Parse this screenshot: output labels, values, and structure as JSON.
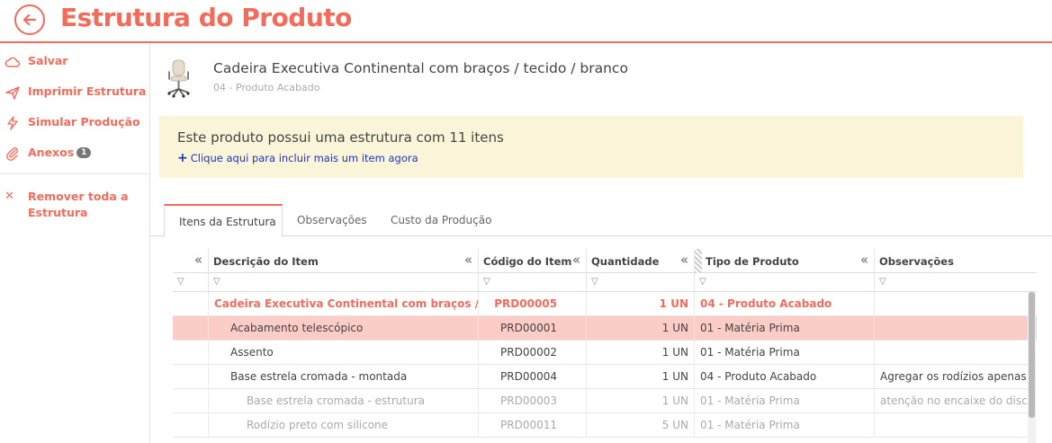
{
  "header": {
    "title": "Estrutura do Produto"
  },
  "sidebar": {
    "items": [
      {
        "label": "Salvar",
        "icon": "cloud-icon"
      },
      {
        "label": "Imprimir Estrutura",
        "icon": "send-icon"
      },
      {
        "label": "Simular Produção",
        "icon": "lightning-icon"
      },
      {
        "label": "Anexos",
        "icon": "paperclip-icon",
        "badge": "1"
      }
    ],
    "remove": {
      "label": "Remover toda a Estrutura",
      "icon": "close-icon"
    }
  },
  "product": {
    "name": "Cadeira Executiva Continental com braços / tecido / branco",
    "type": "04 - Produto Acabado"
  },
  "notice": {
    "text": "Este produto possui uma estrutura com 11 itens",
    "link": "Clique aqui para incluir mais um item agora"
  },
  "tabs": [
    {
      "label": "Itens da Estrutura",
      "active": true
    },
    {
      "label": "Observações",
      "active": false
    },
    {
      "label": "Custo da Produção",
      "active": false
    }
  ],
  "grid": {
    "columns": [
      "Descrição do Item",
      "Código do Item",
      "Quantidade",
      "Tipo de Produto",
      "Observações"
    ],
    "rows": [
      {
        "desc": "Cadeira Executiva Continental com braços / te...",
        "code": "PRD00005",
        "qty": "1 UN",
        "type": "04 - Produto Acabado",
        "obs": ""
      },
      {
        "desc": "Acabamento telescópico",
        "code": "PRD00001",
        "qty": "1 UN",
        "type": "01 - Matéria Prima",
        "obs": ""
      },
      {
        "desc": "Assento",
        "code": "PRD00002",
        "qty": "1 UN",
        "type": "01 - Matéria Prima",
        "obs": ""
      },
      {
        "desc": "Base estrela cromada - montada",
        "code": "PRD00004",
        "qty": "1 UN",
        "type": "04 - Produto Acabado",
        "obs": "Agregar os rodízios apenas em"
      },
      {
        "desc": "Base estrela cromada - estrutura",
        "code": "PRD00003",
        "qty": "1 UN",
        "type": "01 - Matéria Prima",
        "obs": "atenção no encaixe do disco c"
      },
      {
        "desc": "Rodízio preto com silicone",
        "code": "PRD00011",
        "qty": "5 UN",
        "type": "01 - Matéria Prima",
        "obs": ""
      }
    ]
  },
  "colors": {
    "accent": "#f26b5b",
    "selected_row": "#fcccc7",
    "notice_bg": "#faf5d9",
    "link": "#2233bb"
  }
}
